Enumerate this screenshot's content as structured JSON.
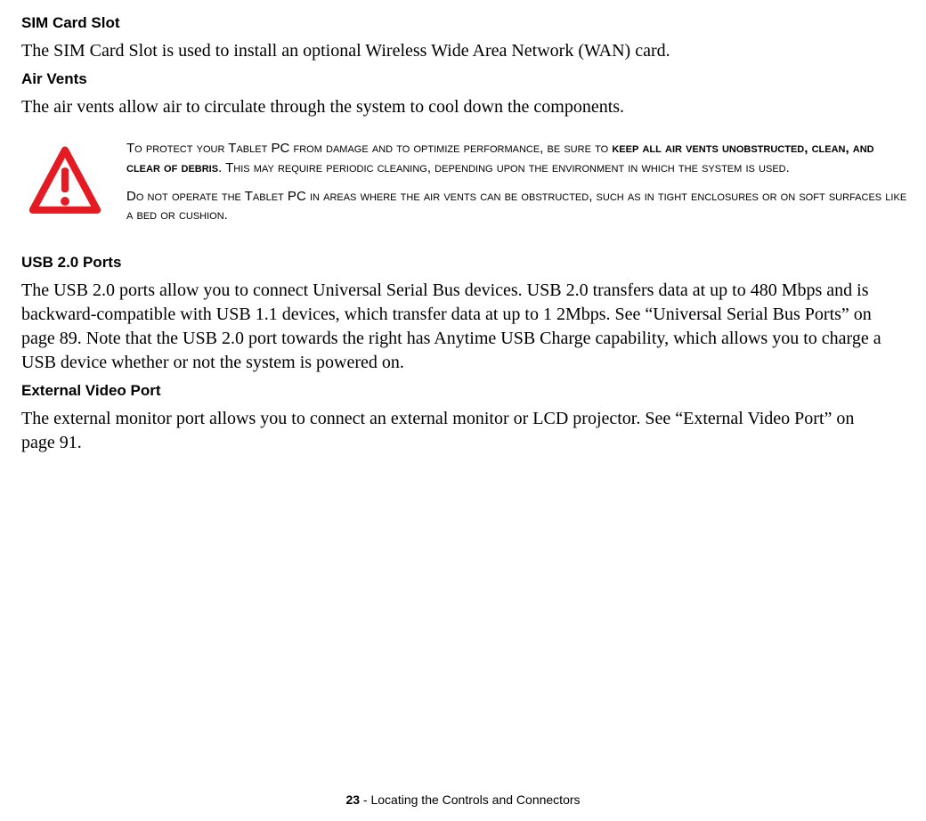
{
  "sim_heading": "SIM Card Slot",
  "sim_body": "The SIM Card Slot is used to install an optional Wireless Wide Area Network (WAN) card.",
  "air_vents_heading": "Air Vents",
  "air_vents_body": "The air vents allow air to circulate through the system to cool down the components.",
  "callout": {
    "p1_pre": "To protect your Tablet PC from damage and to optimize performance, be sure to ",
    "p1_bold": "keep all air vents unobstructed, clean, and clear of debris",
    "p1_post": ". This may require periodic cleaning, depending upon the environment in which the system is used.",
    "p2": "Do not operate the Tablet PC in areas where the air vents can be obstructed, such as in tight enclosures or on soft surfaces like a bed or cushion."
  },
  "usb_heading": "USB 2.0 Ports",
  "usb_body": "The USB 2.0 ports allow you to connect Universal Serial Bus devices. USB 2.0 transfers data at up to 480 Mbps and is backward-compatible with USB 1.1 devices, which transfer data at up to 1 2Mbps. See “Universal Serial Bus Ports” on page 89. Note that the USB 2.0 port towards the right has Anytime USB Charge capability, which allows you to charge a USB device whether or not the system is powered on.",
  "ext_video_heading": "External Video Port",
  "ext_video_body": "The external monitor port allows you to connect an external monitor or LCD projector. See “External Video Port” on page 91.",
  "footer": {
    "page_number": "23",
    "separator": " - ",
    "section": "Locating the Controls and Connectors"
  }
}
